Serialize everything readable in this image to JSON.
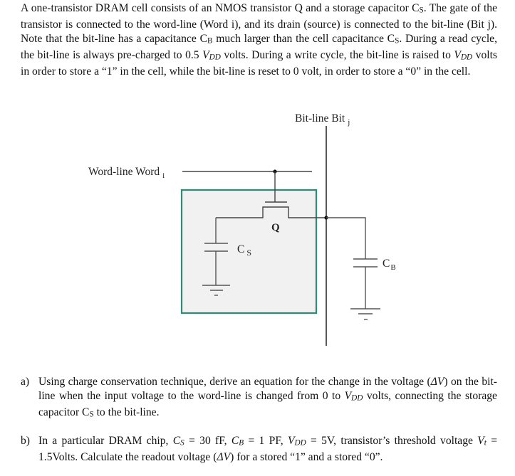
{
  "intro": {
    "p1": "A one-transistor DRAM cell consists of an NMOS transistor Q and a storage capacitor C",
    "p1_sub": "S",
    "p2": ". The gate of the transistor is connected to the word-line (Word i), and its drain (source) is connected to the bit-line (Bit j). Note that the bit-line has a capacitance C",
    "p2_sub": "B",
    "p3": " much larger than the cell capacitance C",
    "p3_sub": "S",
    "p4": ". During a read cycle, the bit-line is always pre-charged to 0.5 ",
    "vdd": "V",
    "vdd_sub": "DD",
    "p5": " volts. During a write cycle, the bit-line is raised to ",
    "p6": " volts in order to store a “1” in the cell, while the bit-line is reset to 0 volt, in order to store a “0” in the cell."
  },
  "diagram": {
    "bitline_label": "Bit-line Bit",
    "bitline_sub": "j",
    "wordline_label": "Word-line Word",
    "wordline_sub": "i",
    "transistor_label": "Q",
    "cs_label": "C",
    "cs_sub": "S",
    "cb_label": "C",
    "cb_sub": "B",
    "colors": {
      "cell_border": "#2e8b74",
      "cell_fill": "#f1f1f1",
      "wire": "#555555",
      "line": "#111111"
    }
  },
  "questions": {
    "a": {
      "label": "a)",
      "t1": "Using charge conservation technique, derive an equation for the change in the voltage (",
      "dv": "ΔV",
      "t2": ") on the bit-line when the input voltage to the word-line is changed from 0 to ",
      "vdd": "V",
      "vdd_sub": "DD",
      "t3": " volts, connecting the storage capacitor C",
      "cs_sub": "S",
      "t4": " to the bit-line."
    },
    "b": {
      "label": "b)",
      "t1": "In a particular DRAM chip, ",
      "cs": "C",
      "cs_sub": "S",
      "t2": " = 30 fF, ",
      "cb": "C",
      "cb_sub": "B",
      "t3": " = 1 PF, ",
      "vdd": "V",
      "vdd_sub": "DD",
      "t4": " = 5V, transistor’s threshold voltage ",
      "vt": "V",
      "vt_sub": "t",
      "t5": " = 1.5Volts. Calculate the readout voltage (",
      "dv": "ΔV",
      "t6": ") for a stored “1” and a stored “0”."
    }
  }
}
